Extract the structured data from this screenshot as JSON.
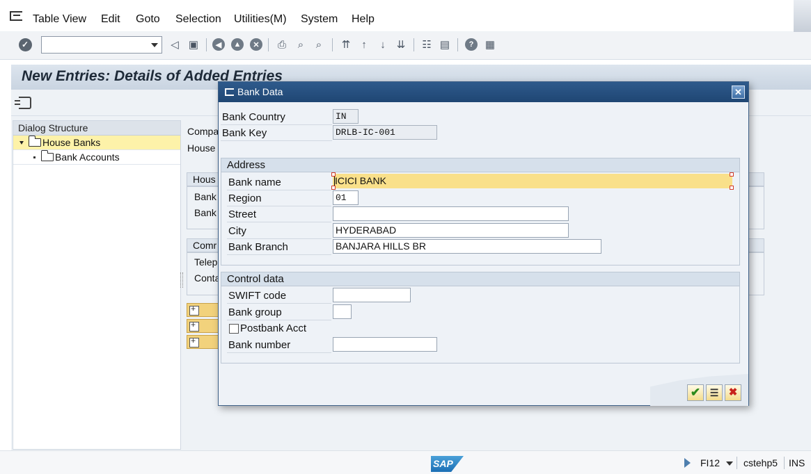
{
  "menu": {
    "items": [
      "Table View",
      "Edit",
      "Goto",
      "Selection",
      "Utilities(M)",
      "System",
      "Help"
    ]
  },
  "toolbar": {
    "command_value": "",
    "icons": [
      "enter-icon",
      "back-icon",
      "save-icon",
      "back-green-icon",
      "exit-icon",
      "cancel-icon",
      "print-icon",
      "find-icon",
      "find-next-icon",
      "first-page-icon",
      "previous-page-icon",
      "next-page-icon",
      "last-page-icon",
      "create-session-icon",
      "shortcut-icon",
      "help-icon",
      "layout-icon"
    ]
  },
  "page": {
    "title": "New Entries: Details of Added Entries"
  },
  "tree": {
    "header": "Dialog Structure",
    "nodes": [
      {
        "label": "House Banks",
        "selected": true
      },
      {
        "label": "Bank Accounts",
        "selected": false
      }
    ]
  },
  "background": {
    "labels": [
      "Compa",
      "House",
      "Hous",
      "Bank",
      "Bank",
      "Comr",
      "Telep",
      "Conta"
    ]
  },
  "dialog": {
    "title": "Bank Data",
    "bank_country_label": "Bank Country",
    "bank_country_value": "IN",
    "bank_key_label": "Bank Key",
    "bank_key_value": "DRLB-IC-001",
    "address": {
      "header": "Address",
      "bank_name_label": "Bank name",
      "bank_name_value": "ICICI BANK",
      "region_label": "Region",
      "region_value": "01",
      "street_label": "Street",
      "street_value": "",
      "city_label": "City",
      "city_value": "HYDERABAD",
      "branch_label": "Bank Branch",
      "branch_value": "BANJARA HILLS BR"
    },
    "control": {
      "header": "Control data",
      "swift_label": "SWIFT code",
      "swift_value": "",
      "group_label": "Bank group",
      "group_value": "",
      "postbank_label": "Postbank Acct",
      "postbank_checked": false,
      "number_label": "Bank number",
      "number_value": ""
    },
    "buttons": {
      "continue": "✔",
      "details": "☰",
      "cancel": "✖"
    }
  },
  "status": {
    "logo": "SAP",
    "transaction": "FI12",
    "server": "cstehp5",
    "mode": "INS"
  },
  "colors": {
    "dialog_title": "#2e5a8c",
    "highlight": "#f9e08a",
    "tree_selected": "#fdf2a9"
  }
}
